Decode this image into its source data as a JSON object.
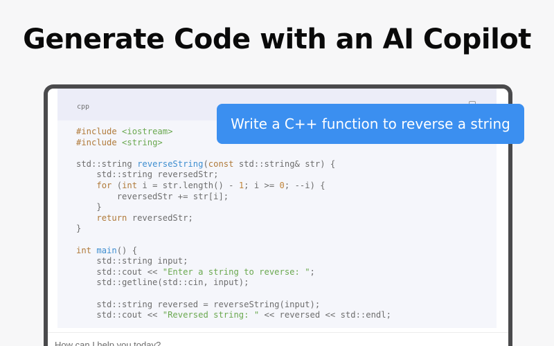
{
  "headline": "Generate Code with an AI Copilot",
  "code_block": {
    "language": "cpp",
    "copy_icon": "copy-icon",
    "lines": [
      [
        {
          "t": "#include ",
          "c": "kw"
        },
        {
          "t": "<iostream>",
          "c": "str"
        }
      ],
      [
        {
          "t": "#include ",
          "c": "kw"
        },
        {
          "t": "<string>",
          "c": "str"
        }
      ],
      [],
      [
        {
          "t": "std::string "
        },
        {
          "t": "reverseString",
          "c": "fn"
        },
        {
          "t": "("
        },
        {
          "t": "const",
          "c": "kw"
        },
        {
          "t": " std::string& str) {"
        }
      ],
      [
        {
          "t": "    std::string reversedStr;"
        }
      ],
      [
        {
          "t": "    "
        },
        {
          "t": "for",
          "c": "kw"
        },
        {
          "t": " ("
        },
        {
          "t": "int",
          "c": "kw"
        },
        {
          "t": " i = str.length() - "
        },
        {
          "t": "1",
          "c": "num"
        },
        {
          "t": "; i >= "
        },
        {
          "t": "0",
          "c": "num"
        },
        {
          "t": "; --i) {"
        }
      ],
      [
        {
          "t": "        reversedStr += str[i];"
        }
      ],
      [
        {
          "t": "    }"
        }
      ],
      [
        {
          "t": "    "
        },
        {
          "t": "return",
          "c": "kw"
        },
        {
          "t": " reversedStr;"
        }
      ],
      [
        {
          "t": "}"
        }
      ],
      [],
      [
        {
          "t": "int",
          "c": "kw"
        },
        {
          "t": " "
        },
        {
          "t": "main",
          "c": "fn"
        },
        {
          "t": "() {"
        }
      ],
      [
        {
          "t": "    std::string input;"
        }
      ],
      [
        {
          "t": "    std::cout << "
        },
        {
          "t": "\"Enter a string to reverse: \"",
          "c": "str"
        },
        {
          "t": ";"
        }
      ],
      [
        {
          "t": "    std::getline(std::cin, input);"
        }
      ],
      [],
      [
        {
          "t": "    std::string reversed = reverseString(input);"
        }
      ],
      [
        {
          "t": "    std::cout << "
        },
        {
          "t": "\"Reversed string: \"",
          "c": "str"
        },
        {
          "t": " << reversed << std::endl;"
        }
      ]
    ]
  },
  "prompt_bubble": "Write a C++ function to reverse a string",
  "chat_input": {
    "placeholder": "How can I help you today?"
  }
}
